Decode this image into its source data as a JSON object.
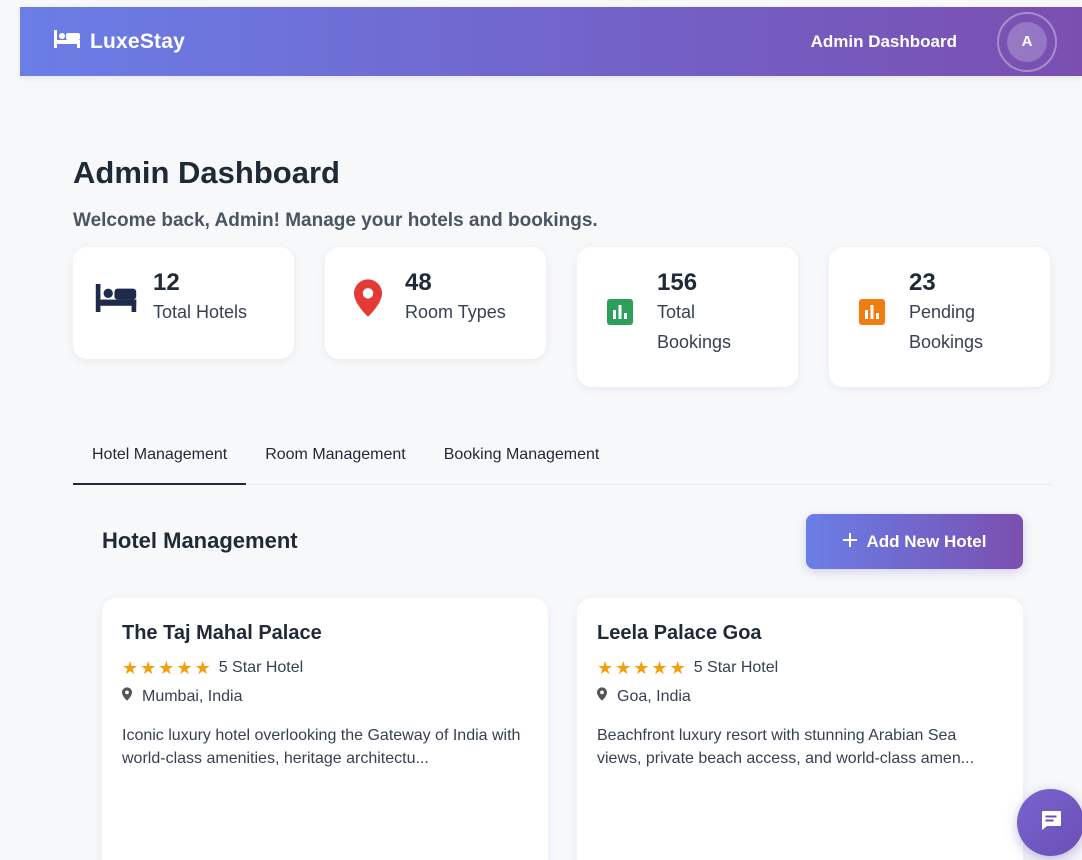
{
  "header": {
    "brand": "LuxeStay",
    "title": "Admin Dashboard",
    "avatar_initial": "A"
  },
  "page": {
    "title": "Admin Dashboard",
    "subtitle": "Welcome back, Admin! Manage your hotels and bookings."
  },
  "stats": [
    {
      "number": "12",
      "label": "Total Hotels",
      "icon": "bed-icon",
      "color": "#1e2a4a"
    },
    {
      "number": "48",
      "label": "Room Types",
      "icon": "map-pin-icon",
      "color": "#e53935"
    },
    {
      "number": "156",
      "label_line1": "Total",
      "label_line2": "Bookings",
      "icon": "bar-chart-icon",
      "color": "#2e9e5b"
    },
    {
      "number": "23",
      "label_line1": "Pending",
      "label_line2": "Bookings",
      "icon": "bar-chart-icon",
      "color": "#f07c12"
    }
  ],
  "tabs": [
    {
      "label": "Hotel Management",
      "active": true
    },
    {
      "label": "Room Management",
      "active": false
    },
    {
      "label": "Booking Management",
      "active": false
    }
  ],
  "section": {
    "title": "Hotel Management",
    "add_button": "Add New Hotel"
  },
  "hotels": [
    {
      "name": "The Taj Mahal Palace",
      "rating_label": "5 Star Hotel",
      "stars": 5,
      "location": "Mumbai, India",
      "description": "Iconic luxury hotel overlooking the Gateway of India with world-class amenities, heritage architectu..."
    },
    {
      "name": "Leela Palace Goa",
      "rating_label": "5 Star Hotel",
      "stars": 5,
      "location": "Goa, India",
      "description": "Beachfront luxury resort with stunning Arabian Sea views, private beach access, and world-class amen..."
    }
  ],
  "colors": {
    "accent_start": "#6a7ee6",
    "accent_end": "#7a4fb0",
    "star": "#f59e0b"
  }
}
